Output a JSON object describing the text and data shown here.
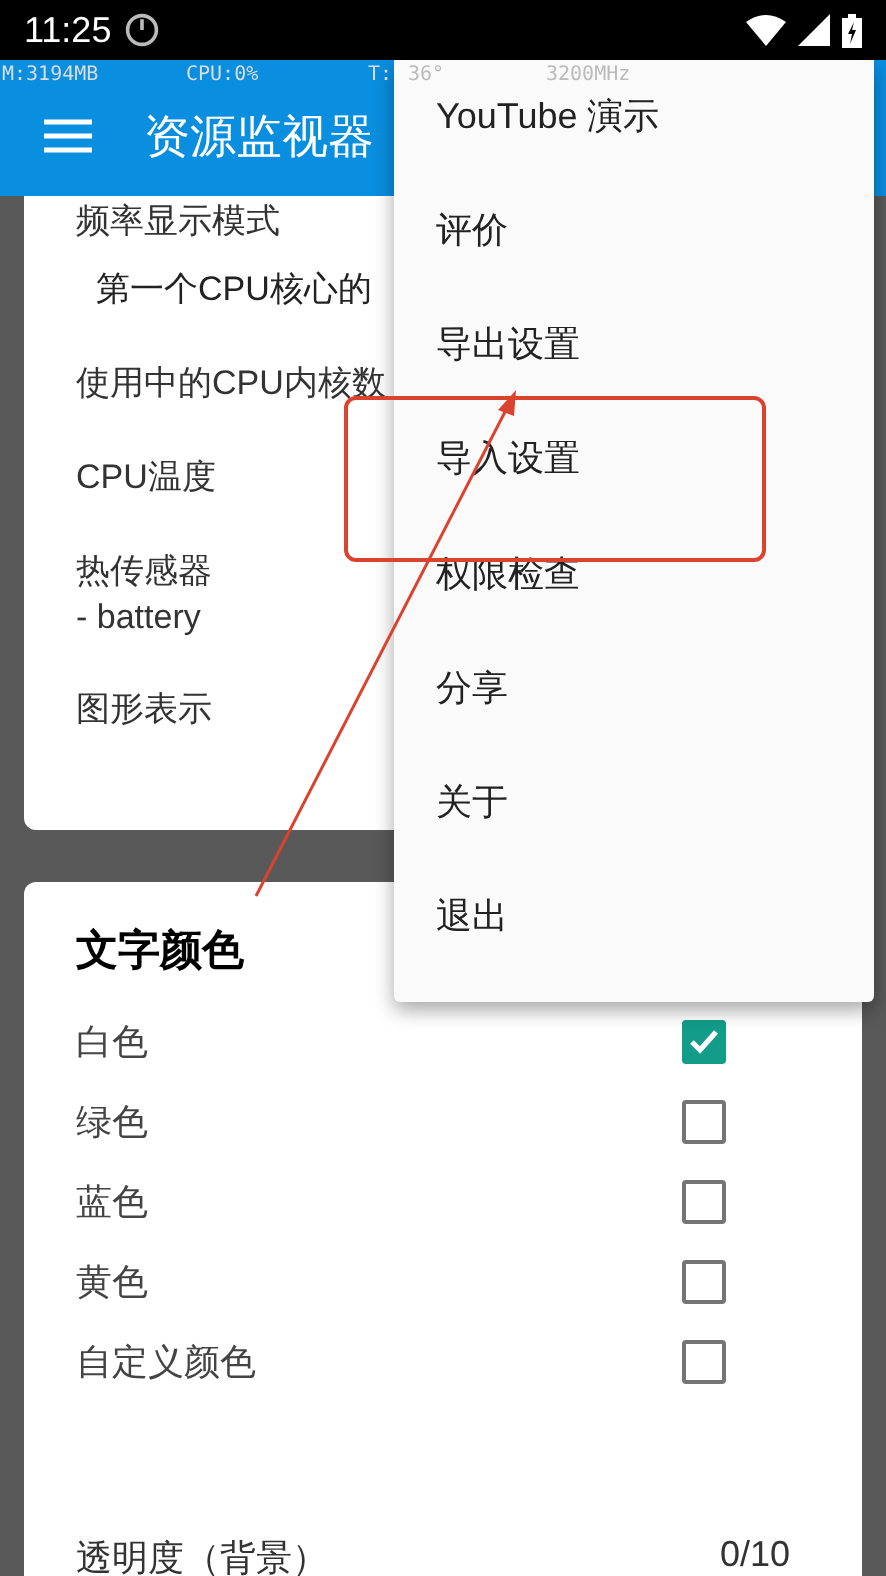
{
  "status_bar": {
    "time": "11:25"
  },
  "monitor_overlay": [
    "M:3194MB",
    "CPU:0%",
    "T:",
    "36°",
    "3200MHz"
  ],
  "app_bar": {
    "title": "资源监视器"
  },
  "settings_card": {
    "rows": [
      {
        "kind": "label",
        "text": "频率显示模式"
      },
      {
        "kind": "value",
        "text": "第一个CPU核心的"
      },
      {
        "kind": "label",
        "text": "使用中的CPU内核数"
      },
      {
        "kind": "label",
        "text": "CPU温度"
      },
      {
        "kind": "label",
        "text": "热传感器"
      },
      {
        "kind": "sub",
        "text": " - battery"
      },
      {
        "kind": "label",
        "text": "图形表示"
      }
    ]
  },
  "text_color_card": {
    "title": "文字颜色",
    "options": [
      {
        "label": "白色",
        "checked": true
      },
      {
        "label": "绿色",
        "checked": false
      },
      {
        "label": "蓝色",
        "checked": false
      },
      {
        "label": "黄色",
        "checked": false
      },
      {
        "label": "自定义颜色",
        "checked": false
      }
    ],
    "transparency": {
      "label": "透明度（背景）",
      "value": "0/10"
    }
  },
  "menu": {
    "items": [
      "YouTube 演示",
      "评价",
      "导出设置",
      "导入设置",
      "权限检查",
      "分享",
      "关于",
      "退出"
    ]
  }
}
